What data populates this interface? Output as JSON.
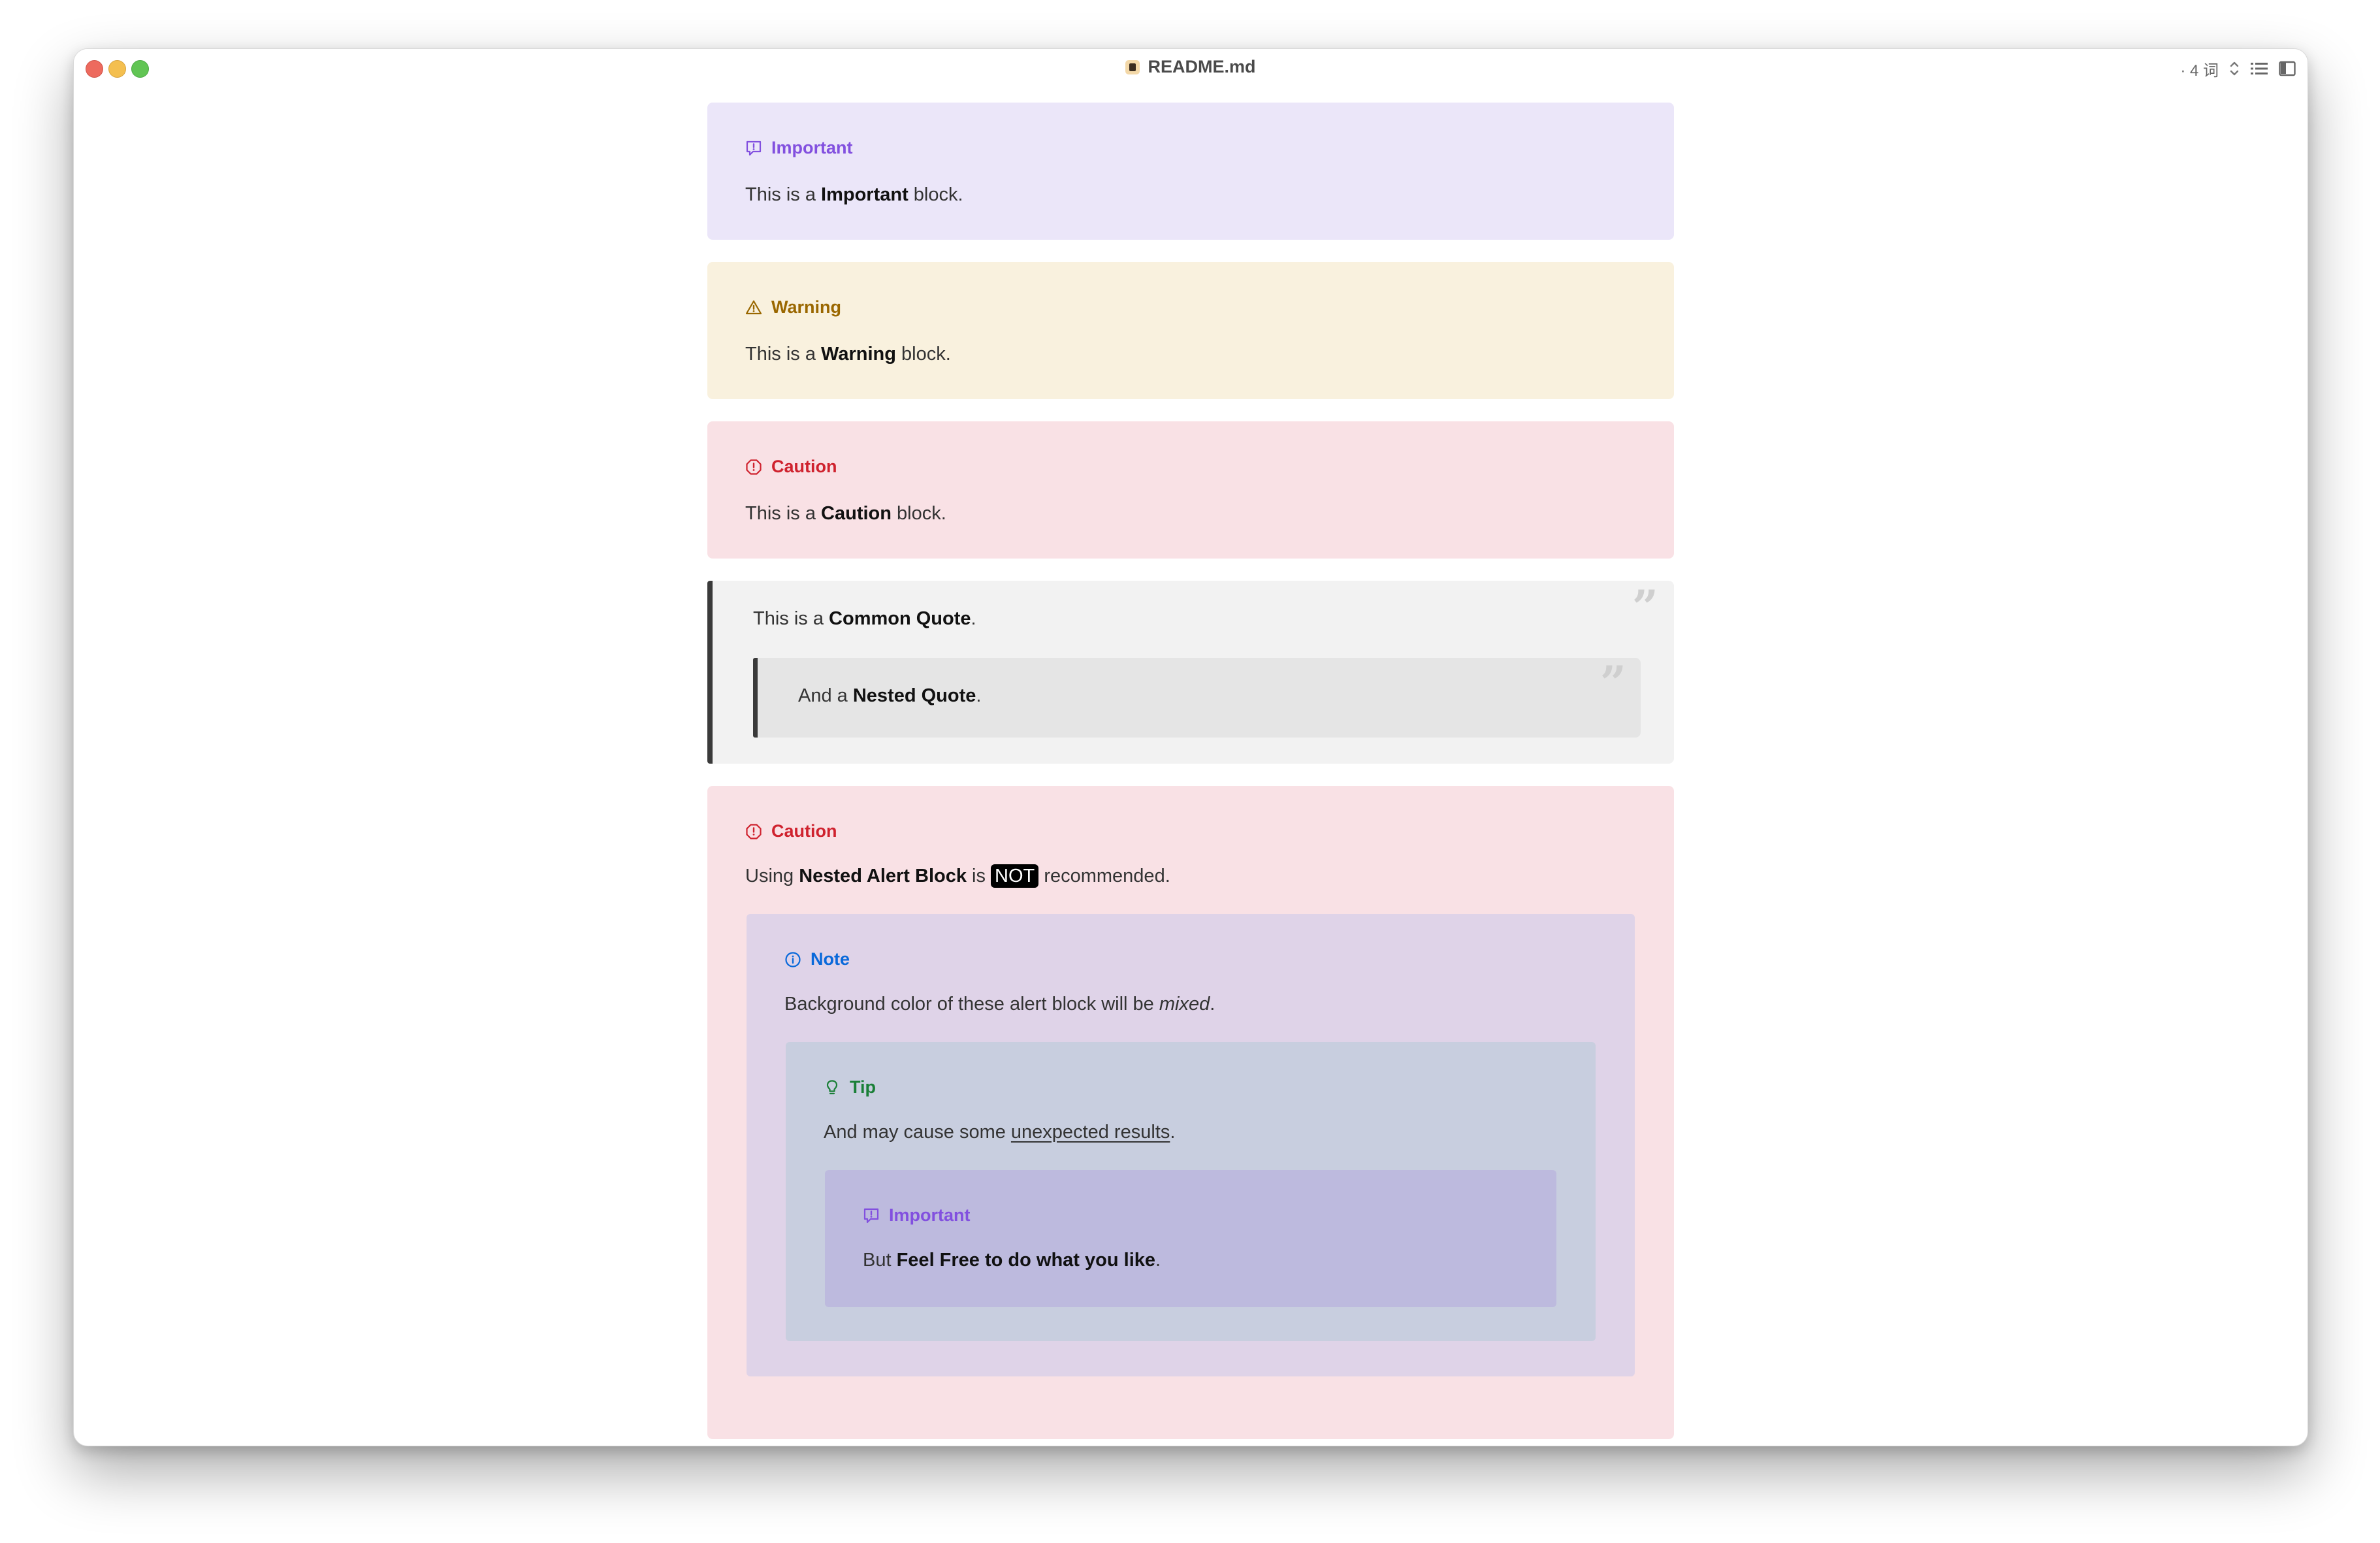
{
  "window": {
    "title": "README.md",
    "word_count": "· 4 词"
  },
  "colors": {
    "important": "#8250df",
    "warning": "#9a6700",
    "caution": "#cf222e",
    "note": "#0969da",
    "tip": "#1a7f37"
  },
  "blocks": {
    "important": {
      "icon": "important-icon",
      "title": "Important",
      "pre": "This is a ",
      "bold": "Important",
      "post": " block."
    },
    "warning": {
      "icon": "warning-icon",
      "title": "Warning",
      "pre": "This is a ",
      "bold": "Warning",
      "post": " block."
    },
    "caution": {
      "icon": "caution-icon",
      "title": "Caution",
      "pre": "This is a ",
      "bold": "Caution",
      "post": " block."
    },
    "quote": {
      "pre": "This is a ",
      "bold": "Common Quote",
      "post": ".",
      "nested_pre": "And a ",
      "nested_bold": "Nested Quote",
      "nested_post": "."
    },
    "nested_caution": {
      "icon": "caution-icon",
      "title": "Caution",
      "pre": "Using ",
      "bold": "Nested Alert Block",
      "mid": " is ",
      "badge": "NOT",
      "post": " recommended.",
      "note": {
        "icon": "info-icon",
        "title": "Note",
        "pre": "Background color of these alert block will be ",
        "italic": "mixed",
        "post": ".",
        "tip": {
          "icon": "lightbulb-icon",
          "title": "Tip",
          "pre": "And may cause some ",
          "underline": "unexpected results",
          "post": ".",
          "important": {
            "icon": "important-icon",
            "title": "Important",
            "pre": "But ",
            "bold": "Feel Free to do what you like",
            "post": "."
          }
        }
      }
    }
  }
}
